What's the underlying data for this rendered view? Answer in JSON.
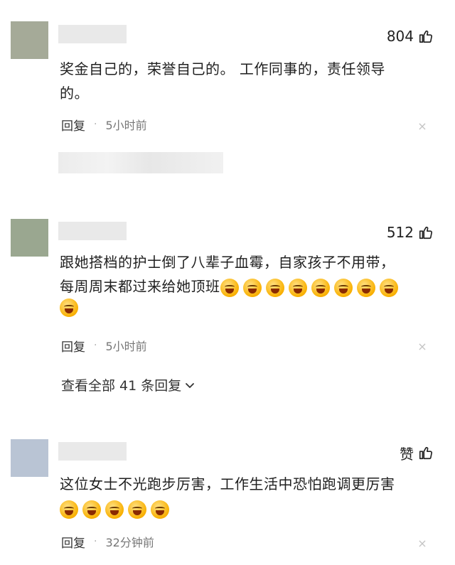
{
  "comments": [
    {
      "likes": "804",
      "avatar_color": "#a5aa98",
      "text_lines": [
        "奖金自己的，荣誉自己的。 工作同事的，责任领导",
        "的。"
      ],
      "reply_label": "回复",
      "dot": "·",
      "time": "5小时前",
      "close": "×"
    },
    {
      "likes": "512",
      "avatar_color": "#9aa790",
      "text_lines": [
        "跟她搭档的护士倒了八辈子血霉，自家孩子不用带，",
        "每周周末都过来给她顶班"
      ],
      "emoji_count_line2": 8,
      "emoji_count_line3": 1,
      "reply_label": "回复",
      "dot": "·",
      "time": "5小时前",
      "close": "×"
    },
    {
      "likes": "赞",
      "avatar_color": "#b9c4d4",
      "text_lines": [
        "这位女士不光跑步厉害，工作生活中恐怕跑调更厉害"
      ],
      "emoji_count_line2": 5,
      "reply_label": "回复",
      "dot": "·",
      "time": "32分钟前",
      "close": "×"
    }
  ],
  "view_all": "查看全部 41 条回复",
  "emoji_name": "laugh-cry-emoji",
  "like_icon": "thumbs-up-icon"
}
